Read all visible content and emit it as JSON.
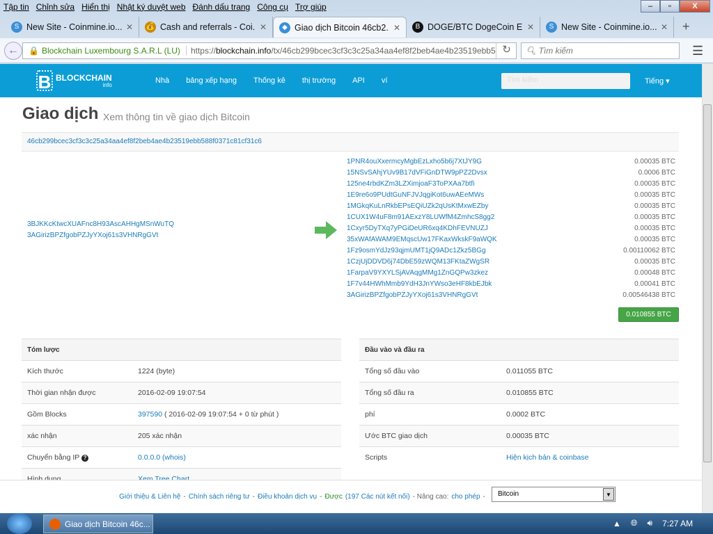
{
  "browser": {
    "menu": [
      "Tập tin",
      "Chỉnh sửa",
      "Hiển thị",
      "Nhật ký duyệt web",
      "Đánh dấu trang",
      "Công cụ",
      "Trợ giúp"
    ],
    "tabs": [
      {
        "label": "New Site - Coinmine.io..."
      },
      {
        "label": "Cash and referrals - Coi..."
      },
      {
        "label": "Giao dịch Bitcoin 46cb2..."
      },
      {
        "label": "DOGE/BTC DogeCoin E..."
      },
      {
        "label": "New Site - Coinmine.io..."
      }
    ],
    "identity": "Blockchain Luxembourg S.A.R.L (LU)",
    "url_prefix": "https://",
    "url_host": "blockchain.info",
    "url_path": "/tx/46cb299bcec3cf3c3c25a34aa4ef8f2beb4ae4b23519ebb5",
    "search_placeholder": "Tìm kiếm"
  },
  "site": {
    "logo": "BLOCKCHAIN",
    "logo_sub": "info",
    "nav": [
      "Nhà",
      "bảng xếp hạng",
      "Thống kê",
      "thị trường",
      "API",
      "ví"
    ],
    "search_placeholder": "Tìm kiếm",
    "language": "Tiếng ▾"
  },
  "page": {
    "title": "Giao dịch",
    "subtitle": "Xem thông tin về giao dịch Bitcoin",
    "hash": "46cb299bcec3cf3c3c25a34aa4ef8f2beb4ae4b23519ebb588f0371c81cf31c6"
  },
  "inputs": [
    "3BJKKcKtwcXUAFnc8H93AscAHHgMSnWuTQ",
    "3AGirizBPZfgobPZJyYXoj61s3VHNRgGVt"
  ],
  "outputs": [
    {
      "address": "1PNR4ouXxermcyMgbEzLxho5b6j7XtJY9G",
      "amount": "0.00035 BTC"
    },
    {
      "address": "15NSvSAhjYUv9B17dVFiGnDTW9pPZ2Dvsx",
      "amount": "0.0006 BTC"
    },
    {
      "address": "125ne4rbdKZm3LZXimjoaF3ToPXAa7btfi",
      "amount": "0.00035 BTC"
    },
    {
      "address": "1E9re6o9PUdtGuNFJVJqgiKot6uwAEeMWs",
      "amount": "0.00035 BTC"
    },
    {
      "address": "1MGkqKuLnRkbEPsEQiUZk2qUsKtMxwEZby",
      "amount": "0.00035 BTC"
    },
    {
      "address": "1CUX1W4uF8m91AExzY8LUWfM4ZmhcS8gg2",
      "amount": "0.00035 BTC"
    },
    {
      "address": "1Cxyr5DyTXq7yPGiDeUR6xq4KDhFEVNUZJ",
      "amount": "0.00035 BTC"
    },
    {
      "address": "35xWAfAWAM9EMqscUw17FKaxWkskF9aWQK",
      "amount": "0.00035 BTC"
    },
    {
      "address": "1Fz9osmYdJz93qjmUMT1jQ9ADc1Zkz5BGg",
      "amount": "0.00110062 BTC"
    },
    {
      "address": "1CzjUjDDVD6j74DbE59zWQM13FKtaZWgSR",
      "amount": "0.00035 BTC"
    },
    {
      "address": "1FarpaV9YXYLSjAVAqgMMg1ZnGQPw3zkez",
      "amount": "0.00048 BTC"
    },
    {
      "address": "1F7v44HWhMmb9YdH3JnYWso3eHF8kbEJbk",
      "amount": "0.00041 BTC"
    },
    {
      "address": "3AGirizBPZfgobPZJyYXoj61s3VHNRgGVt",
      "amount": "0.00546438 BTC"
    }
  ],
  "total": "0.010855 BTC",
  "summary": {
    "heading": "Tóm lược",
    "rows": [
      {
        "label": "Kích thước",
        "value": "1224 (byte)"
      },
      {
        "label": "Thời gian nhận được",
        "value": "2016-02-09 19:07:54"
      },
      {
        "label": "Gồm Blocks",
        "link": "397590",
        "value": " ( 2016-02-09 19:07:54 + 0 từ phút )"
      },
      {
        "label": "xác nhận",
        "value": "205 xác nhận"
      },
      {
        "label": "Chuyển bằng IP",
        "link": "0.0.0.0 (whois)"
      },
      {
        "label": "Hình dung",
        "link": "Xem Tree Chart"
      }
    ]
  },
  "io": {
    "heading": "Đầu vào và đầu ra",
    "rows": [
      {
        "label": "Tổng số đầu vào",
        "value": "0.011055 BTC"
      },
      {
        "label": "Tổng số đầu ra",
        "value": "0.010855 BTC"
      },
      {
        "label": "phí",
        "value": "0.0002 BTC"
      },
      {
        "label": "Ước BTC giao dịch",
        "value": "0.00035 BTC"
      },
      {
        "label": "Scripts",
        "link": "Hiện kịch bản & coinbase"
      }
    ]
  },
  "footer": {
    "about": "Giới thiệu & Liên hệ",
    "sep": " - ",
    "privacy": "Chính sách riêng tư",
    "terms": "Điều khoản dịch vụ",
    "status": "Được",
    "nodes": "(197 Các nút kết nối)",
    "advanced": "- Nâng cao:",
    "allow": "cho phép",
    "currency": "Bitcoin"
  },
  "taskbar": {
    "task": "Giao dịch Bitcoin 46c...",
    "time": "7:27 AM"
  }
}
